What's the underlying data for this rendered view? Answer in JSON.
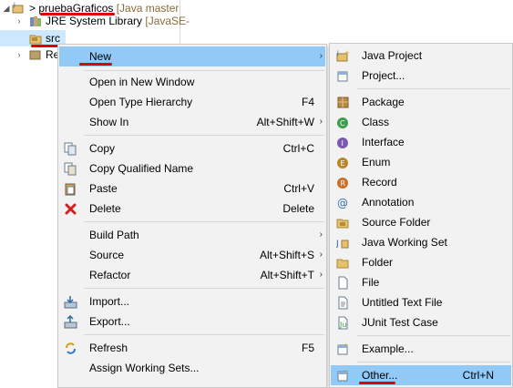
{
  "tree": {
    "project": {
      "prefix": "> ",
      "name": "pruebaGraficos",
      "deco": " [Java master"
    },
    "jre": {
      "name": "JRE System Library",
      "deco": " [JavaSE-"
    },
    "src": {
      "name": "src"
    },
    "ref": {
      "name": "Re"
    }
  },
  "menu": {
    "new": "New",
    "open_new_window": "Open in New Window",
    "open_type_hierarchy": "Open Type Hierarchy",
    "open_type_hierarchy_sc": "F4",
    "show_in": "Show In",
    "show_in_sc": "Alt+Shift+W",
    "copy": "Copy",
    "copy_sc": "Ctrl+C",
    "copy_qualified": "Copy Qualified Name",
    "paste": "Paste",
    "paste_sc": "Ctrl+V",
    "delete": "Delete",
    "delete_sc": "Delete",
    "build_path": "Build Path",
    "source": "Source",
    "source_sc": "Alt+Shift+S",
    "refactor": "Refactor",
    "refactor_sc": "Alt+Shift+T",
    "import": "Import...",
    "export": "Export...",
    "refresh": "Refresh",
    "refresh_sc": "F5",
    "assign_working_sets": "Assign Working Sets..."
  },
  "submenu": {
    "java_project": "Java Project",
    "project": "Project...",
    "package": "Package",
    "class": "Class",
    "interface": "Interface",
    "enum": "Enum",
    "record": "Record",
    "annotation": "Annotation",
    "source_folder": "Source Folder",
    "java_working_set": "Java Working Set",
    "folder": "Folder",
    "file": "File",
    "untitled_text_file": "Untitled Text File",
    "junit_test_case": "JUnit Test Case",
    "example": "Example...",
    "other": "Other...",
    "other_sc": "Ctrl+N"
  },
  "colors": {
    "highlight": "#91c9f7",
    "annotation_red": "#e00000",
    "menu_bg": "#f2f2f2"
  }
}
